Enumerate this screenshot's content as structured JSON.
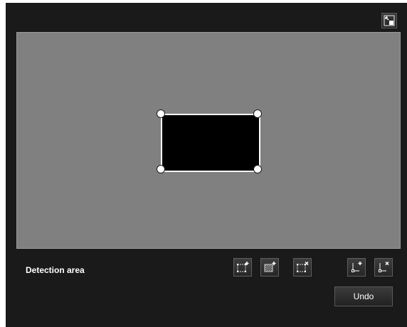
{
  "icons": {
    "corner": "restore-size-icon",
    "add_area": "add-area-icon",
    "add_mask": "add-mask-area-icon",
    "delete_area": "delete-area-icon",
    "add_vertex": "add-vertex-icon",
    "delete_vertex": "delete-vertex-icon"
  },
  "panel": {
    "detection_area_label": "Detection area",
    "undo_label": "Undo"
  },
  "colors": {
    "background": "#1a1a1a",
    "canvas": "#808080",
    "area_fill": "#000000",
    "area_outline": "#ffffff"
  }
}
